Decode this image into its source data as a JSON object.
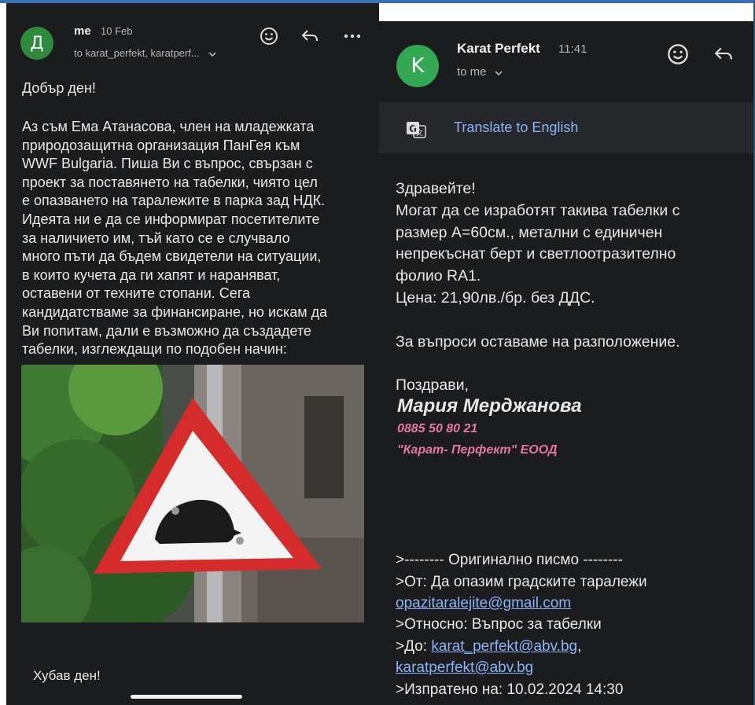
{
  "left_email": {
    "avatar_letter": "Д",
    "sender": "me",
    "date": "10 Feb",
    "recipients": "to karat_perfekt, karatperf...",
    "greeting": "Добър ден!",
    "paragraph": "Аз съм Ема Атанасова, член на младежката\nприродозащитна организация ПанГея към\nWWF Bulgaria. Пиша Ви с въпрос, свързан с\nпроект за поставянето на табелки, чиято цел\nе опазването на таралежите в парка зад НДК.\nИдеята ни е да се информират посетителите\nза наличието им, тъй като се е случвало\nмного пъти да бъдем свидетели на ситуации,\nв които кучета да ги хапят и нараняват,\nоставени от техните стопани. Сега\nкандидатстваме за финансиране, но искам да\nВи попитам, дали е възможно да създадете\nтабелки, изглеждащи по подобен начин:",
    "closing": "Хубав ден!"
  },
  "right_email": {
    "avatar_letter": "K",
    "sender": "Karat Perfekt",
    "time": "11:41",
    "recipients": "to me",
    "translate_label": "Translate to English",
    "greeting": "Здравейте!",
    "body": "Могат да се изработят такива табелки с\nразмер А=60см., метални с единичен\nнепрекъснат берт и светлоотразително\nфолио RA1.",
    "price": "Цена: 21,90лв./бр. без ДДС.",
    "questions": "За въпроси оставаме на разположение.",
    "regards": "Поздрави,",
    "signature_name": "Мария Мерджанова",
    "signature_phone": "0885 50 80 21",
    "signature_company": "\"Карат- Перфект\" ЕООД",
    "original": {
      "header": ">-------- Оригинално писмо --------",
      "from_prefix": ">От: Да опазим градските таралежи",
      "from_email": "opazitaralejite@gmail.com",
      "subject": ">Относно: Въпрос за табелки",
      "to_prefix": ">До: ",
      "to_email_1": "karat_perfekt@abv.bg",
      "to_sep": ",",
      "to_email_2": "karatperfekt@abv.bg",
      "sent": ">Изпратено на: 10.02.2024 14:30"
    }
  },
  "colors": {
    "panel_bg": "#1b1c1e",
    "link": "#8ab4f8",
    "signature_pink": "#e776a6",
    "left_avatar": "#2e8b3d",
    "right_avatar": "#33a852"
  },
  "icons": [
    "emoji-reaction-icon",
    "reply-icon",
    "more-options-icon",
    "chevron-down-icon",
    "translate-icon"
  ]
}
